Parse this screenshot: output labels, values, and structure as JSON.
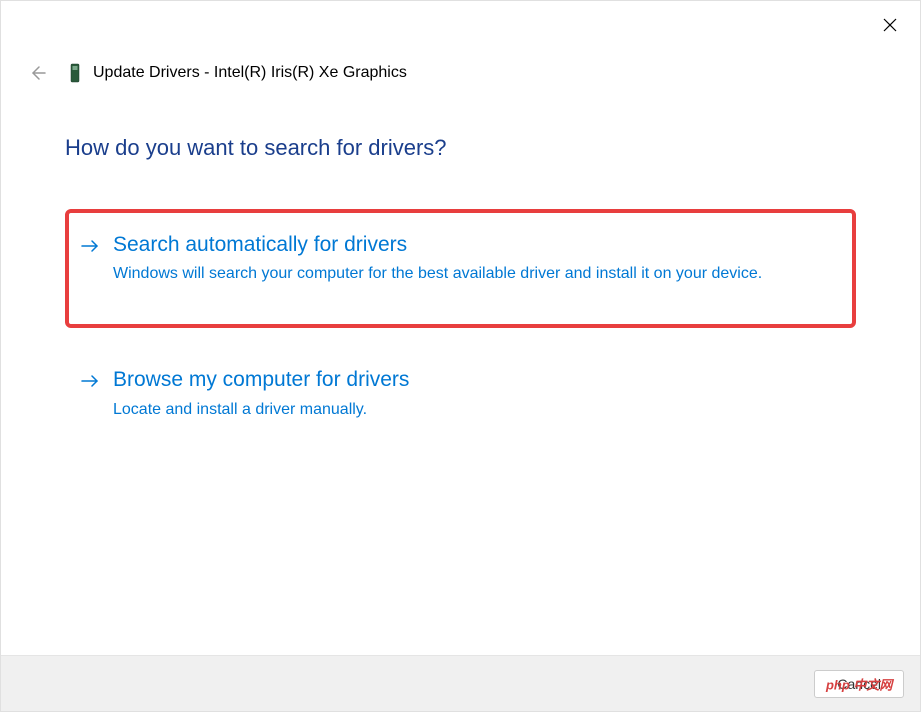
{
  "window": {
    "title": "Update Drivers - Intel(R) Iris(R) Xe Graphics"
  },
  "question": "How do you want to search for drivers?",
  "options": [
    {
      "title": "Search automatically for drivers",
      "description": "Windows will search your computer for the best available driver and install it on your device."
    },
    {
      "title": "Browse my computer for drivers",
      "description": "Locate and install a driver manually."
    }
  ],
  "footer": {
    "cancel_label": "Cancel"
  },
  "watermark": "php 中文网"
}
